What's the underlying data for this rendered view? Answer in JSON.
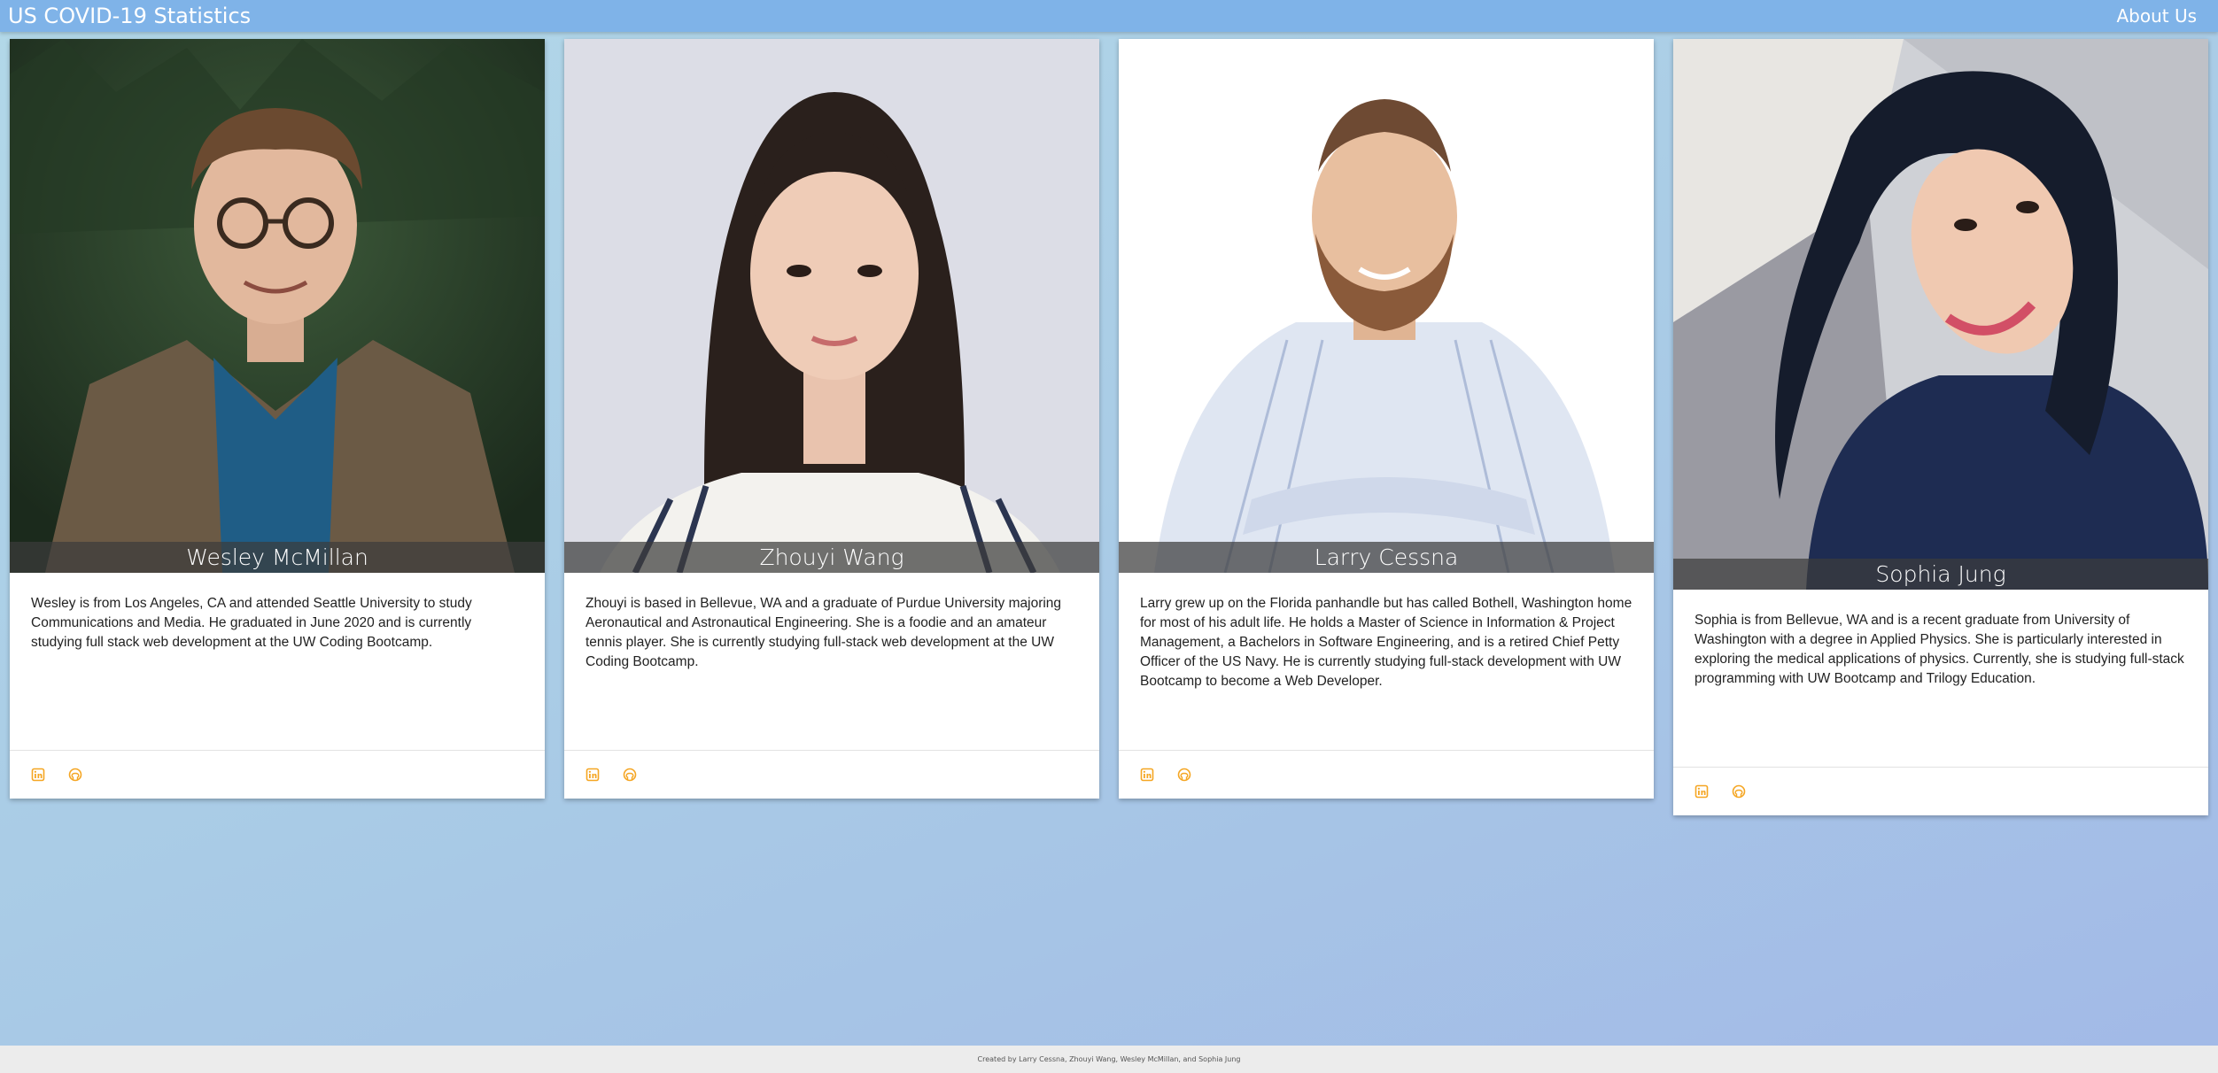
{
  "navbar": {
    "brand": "US COVID-19 Statistics",
    "about_link": "About Us"
  },
  "team": [
    {
      "name": "Wesley McMillan",
      "bio": "Wesley is from Los Angeles, CA and attended Seattle University to study Communications and Media. He graduated in June 2020 and is currently studying full stack web development at the UW Coding Bootcamp.",
      "links": [
        "linkedin-icon",
        "github-icon"
      ]
    },
    {
      "name": "Zhouyi Wang",
      "bio": "Zhouyi is based in Bellevue, WA and a graduate of Purdue University majoring Aeronautical and Astronautical Engineering. She is a foodie and an amateur tennis player. She is currently studying full-stack web development at the UW Coding Bootcamp.",
      "links": [
        "linkedin-icon",
        "github-icon"
      ]
    },
    {
      "name": "Larry Cessna",
      "bio": "Larry grew up on the Florida panhandle but has called Bothell, Washington home for most of his adult life. He holds a Master of Science in Information & Project Management, a Bachelors in Software Engineering, and is a retired Chief Petty Officer of the US Navy. He is currently studying full-stack development with UW Bootcamp to become a Web Developer.",
      "links": [
        "linkedin-icon",
        "github-icon"
      ]
    },
    {
      "name": "Sophia Jung",
      "bio": "Sophia is from Bellevue, WA and is a recent graduate from University of Washington with a degree in Applied Physics. She is particularly interested in exploring the medical applications of physics. Currently, she is studying full-stack programming with UW Bootcamp and Trilogy Education.",
      "links": [
        "linkedin-icon",
        "github-icon"
      ]
    }
  ],
  "colors": {
    "navbar": "#7fb3e8",
    "icon_accent": "#f5a623"
  },
  "footer": {
    "credit": "Created by Larry Cessna, Zhouyi Wang, Wesley McMillan, and Sophia Jung"
  }
}
